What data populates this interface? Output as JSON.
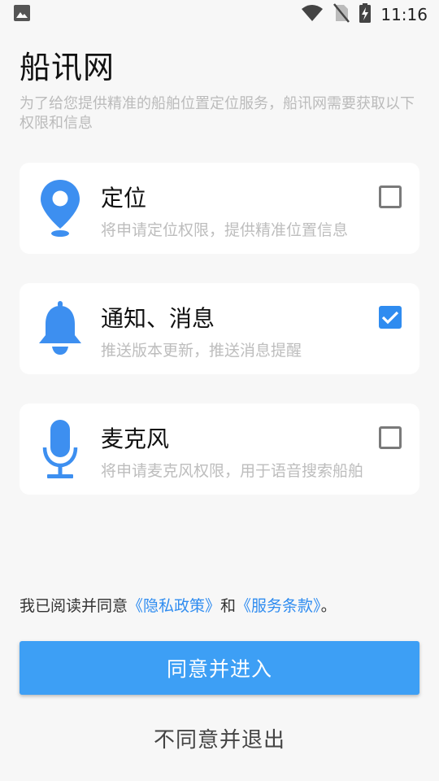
{
  "status_bar": {
    "time": "11:16",
    "icons": [
      "image-icon",
      "wifi-icon",
      "no-sim-icon",
      "battery-charging-icon"
    ]
  },
  "header": {
    "title": "船讯网",
    "subtitle": "为了给您提供精准的船舶位置定位服务，船讯网需要获取以下权限和信息"
  },
  "permissions": [
    {
      "icon": "location-pin-icon",
      "name": "定位",
      "desc": "将申请定位权限，提供精准位置信息",
      "checked": false
    },
    {
      "icon": "bell-icon",
      "name": "通知、消息",
      "desc": "推送版本更新，推送消息提醒",
      "checked": true
    },
    {
      "icon": "microphone-icon",
      "name": "麦克风",
      "desc": "将申请麦克风权限，用于语音搜索船舶",
      "checked": false
    }
  ],
  "agreement": {
    "prefix": "我已阅读并同意",
    "privacy_link": "《隐私政策》",
    "and": "和",
    "terms_link": "《服务条款》",
    "suffix": "。"
  },
  "buttons": {
    "accept": "同意并进入",
    "decline": "不同意并退出"
  },
  "colors": {
    "accent": "#3d9ff5",
    "link": "#2f8cf0",
    "background": "#f7f7f7"
  }
}
